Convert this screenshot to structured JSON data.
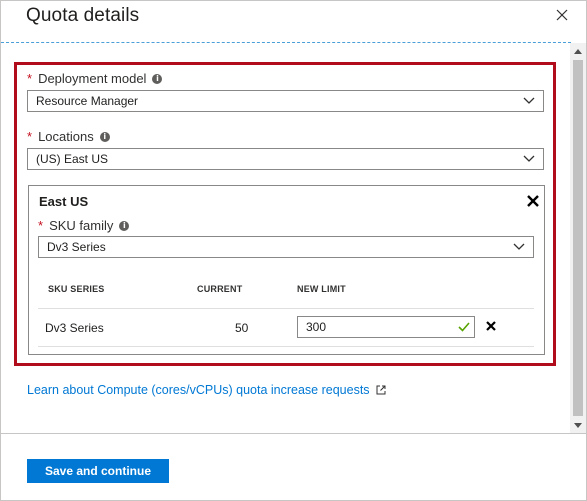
{
  "header": {
    "title": "Quota details",
    "close_icon": "close-icon"
  },
  "form": {
    "deployment_model": {
      "required_mark": "*",
      "label": "Deployment model",
      "value": "Resource Manager"
    },
    "locations": {
      "required_mark": "*",
      "label": "Locations",
      "value": "(US) East US"
    },
    "region": {
      "title": "East US",
      "sku_family": {
        "required_mark": "*",
        "label": "SKU family",
        "value": "Dv3 Series"
      },
      "table": {
        "columns": [
          "SKU SERIES",
          "CURRENT",
          "NEW LIMIT"
        ],
        "rows": [
          {
            "sku_series": "Dv3 Series",
            "current": "50",
            "new_limit": "300"
          }
        ]
      }
    }
  },
  "learn_link": "Learn about Compute (cores/vCPUs) quota increase requests",
  "footer": {
    "primary_label": "Save and continue"
  },
  "colors": {
    "accent": "#0078d4",
    "highlight_border": "#b00c1c",
    "required": "#c50f1f",
    "valid_check": "#57a300"
  }
}
